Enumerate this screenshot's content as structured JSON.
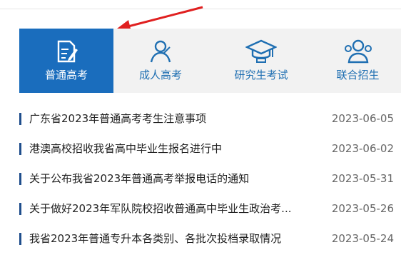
{
  "tabs": [
    {
      "label": "普通高考",
      "icon": "exam-paper-pen-icon",
      "active": true
    },
    {
      "label": "成人高考",
      "icon": "adult-person-icon",
      "active": false
    },
    {
      "label": "研究生考试",
      "icon": "graduate-cap-icon",
      "active": false
    },
    {
      "label": "联合招生",
      "icon": "group-people-icon",
      "active": false
    }
  ],
  "news": [
    {
      "title": "广东省2023年普通高考考生注意事项",
      "date": "2023-06-05"
    },
    {
      "title": "港澳高校招收我省高中毕业生报名进行中",
      "date": "2023-06-02"
    },
    {
      "title": "关于公布我省2023年普通高考举报电话的通知",
      "date": "2023-05-31"
    },
    {
      "title": "关于做好2023年军队院校招收普通高中毕业生政治考...",
      "date": "2023-05-26"
    },
    {
      "title": "我省2023年普通专升本各类别、各批次投档录取情况",
      "date": "2023-05-24"
    }
  ],
  "colors": {
    "accent": "#1a6dbd",
    "tab_bg": "#f2f2f2",
    "arrow": "#e02020"
  }
}
